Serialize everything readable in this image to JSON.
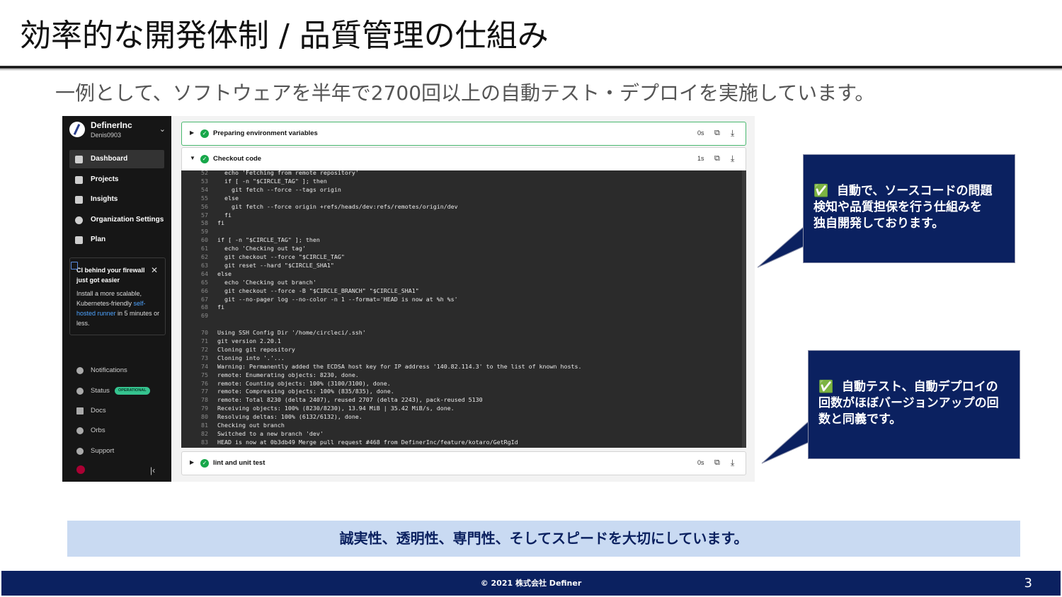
{
  "slide": {
    "title": "効率的な開発体制 / 品質管理の仕組み",
    "subtitle": "一例として、ソフトウェアを半年で2700回以上の自動テスト・デプロイを実施しています。"
  },
  "sidebar": {
    "org_name": "DefinerInc",
    "org_user": "Denis0903",
    "items": [
      {
        "label": "Dashboard",
        "icon": "dashboard-icon"
      },
      {
        "label": "Projects",
        "icon": "projects-icon"
      },
      {
        "label": "Insights",
        "icon": "insights-icon"
      },
      {
        "label": "Organization Settings",
        "icon": "gear-icon"
      },
      {
        "label": "Plan",
        "icon": "dollar-icon"
      }
    ],
    "promo": {
      "title": "CI behind your firewall just got easier",
      "body_pre": "Install a more scalable, Kubernetes-friendly ",
      "link": "self-hosted runner",
      "body_post": " in 5 minutes or less."
    },
    "bottom_items": [
      {
        "label": "Notifications",
        "icon": "bell-icon"
      },
      {
        "label": "Status",
        "icon": "status-icon",
        "badge": "OPERATIONAL"
      },
      {
        "label": "Docs",
        "icon": "docs-icon"
      },
      {
        "label": "Orbs",
        "icon": "orbs-icon"
      },
      {
        "label": "Support",
        "icon": "help-icon"
      }
    ]
  },
  "steps": [
    {
      "name": "Preparing environment variables",
      "duration": "0s",
      "expanded": false
    },
    {
      "name": "Checkout code",
      "duration": "1s",
      "expanded": true
    },
    {
      "name": "lint and unit test",
      "duration": "0s",
      "expanded": false
    }
  ],
  "code_lines": [
    {
      "n": "52",
      "t": "  echo 'Fetching from remote repository'"
    },
    {
      "n": "53",
      "t": "  if [ -n \"$CIRCLE_TAG\" ]; then"
    },
    {
      "n": "54",
      "t": "    git fetch --force --tags origin"
    },
    {
      "n": "55",
      "t": "  else"
    },
    {
      "n": "56",
      "t": "    git fetch --force origin +refs/heads/dev:refs/remotes/origin/dev"
    },
    {
      "n": "57",
      "t": "  fi"
    },
    {
      "n": "58",
      "t": "fi"
    },
    {
      "n": "59",
      "t": ""
    },
    {
      "n": "60",
      "t": "if [ -n \"$CIRCLE_TAG\" ]; then"
    },
    {
      "n": "61",
      "t": "  echo 'Checking out tag'"
    },
    {
      "n": "62",
      "t": "  git checkout --force \"$CIRCLE_TAG\""
    },
    {
      "n": "63",
      "t": "  git reset --hard \"$CIRCLE_SHA1\""
    },
    {
      "n": "64",
      "t": "else"
    },
    {
      "n": "65",
      "t": "  echo 'Checking out branch'"
    },
    {
      "n": "66",
      "t": "  git checkout --force -B \"$CIRCLE_BRANCH\" \"$CIRCLE_SHA1\""
    },
    {
      "n": "67",
      "t": "  git --no-pager log --no-color -n 1 --format='HEAD is now at %h %s'"
    },
    {
      "n": "68",
      "t": "fi"
    },
    {
      "n": "69",
      "t": ""
    },
    {
      "n": "",
      "t": ""
    },
    {
      "n": "70",
      "t": "Using SSH Config Dir '/home/circleci/.ssh'"
    },
    {
      "n": "71",
      "t": "git version 2.20.1"
    },
    {
      "n": "72",
      "t": "Cloning git repository"
    },
    {
      "n": "73",
      "t": "Cloning into '.'..."
    },
    {
      "n": "74",
      "t": "Warning: Permanently added the ECDSA host key for IP address '140.82.114.3' to the list of known hosts."
    },
    {
      "n": "75",
      "t": "remote: Enumerating objects: 8230, done."
    },
    {
      "n": "76",
      "t": "remote: Counting objects: 100% (3100/3100), done."
    },
    {
      "n": "77",
      "t": "remote: Compressing objects: 100% (835/835), done."
    },
    {
      "n": "78",
      "t": "remote: Total 8230 (delta 2407), reused 2707 (delta 2243), pack-reused 5130"
    },
    {
      "n": "79",
      "t": "Receiving objects: 100% (8230/8230), 13.94 MiB | 35.42 MiB/s, done."
    },
    {
      "n": "80",
      "t": "Resolving deltas: 100% (6132/6132), done."
    },
    {
      "n": "81",
      "t": "Checking out branch"
    },
    {
      "n": "82",
      "t": "Switched to a new branch 'dev'"
    },
    {
      "n": "83",
      "t": "HEAD is now at 0b3db49 Merge pull request #468 from DefinerInc/feature/kotaro/GetRgId"
    }
  ],
  "callouts": [
    {
      "check": "✅",
      "text": "自動で、ソースコードの問題\n検知や品質担保を行う仕組みを\n独自開発しております。"
    },
    {
      "check": "✅",
      "text": "自動テスト、自動デプロイの\n回数がほぼバージョンアップの回\n数と同義です。"
    }
  ],
  "banner": "誠実性、透明性、専門性、そしてスピードを大切にしています。",
  "footer": {
    "copyright": "© 2021 株式会社 Definer",
    "page": "3"
  },
  "colors": {
    "navy": "#0b2160",
    "banner_bg": "#c9daf2",
    "sidebar_bg": "#161616",
    "success": "#17a74a"
  }
}
